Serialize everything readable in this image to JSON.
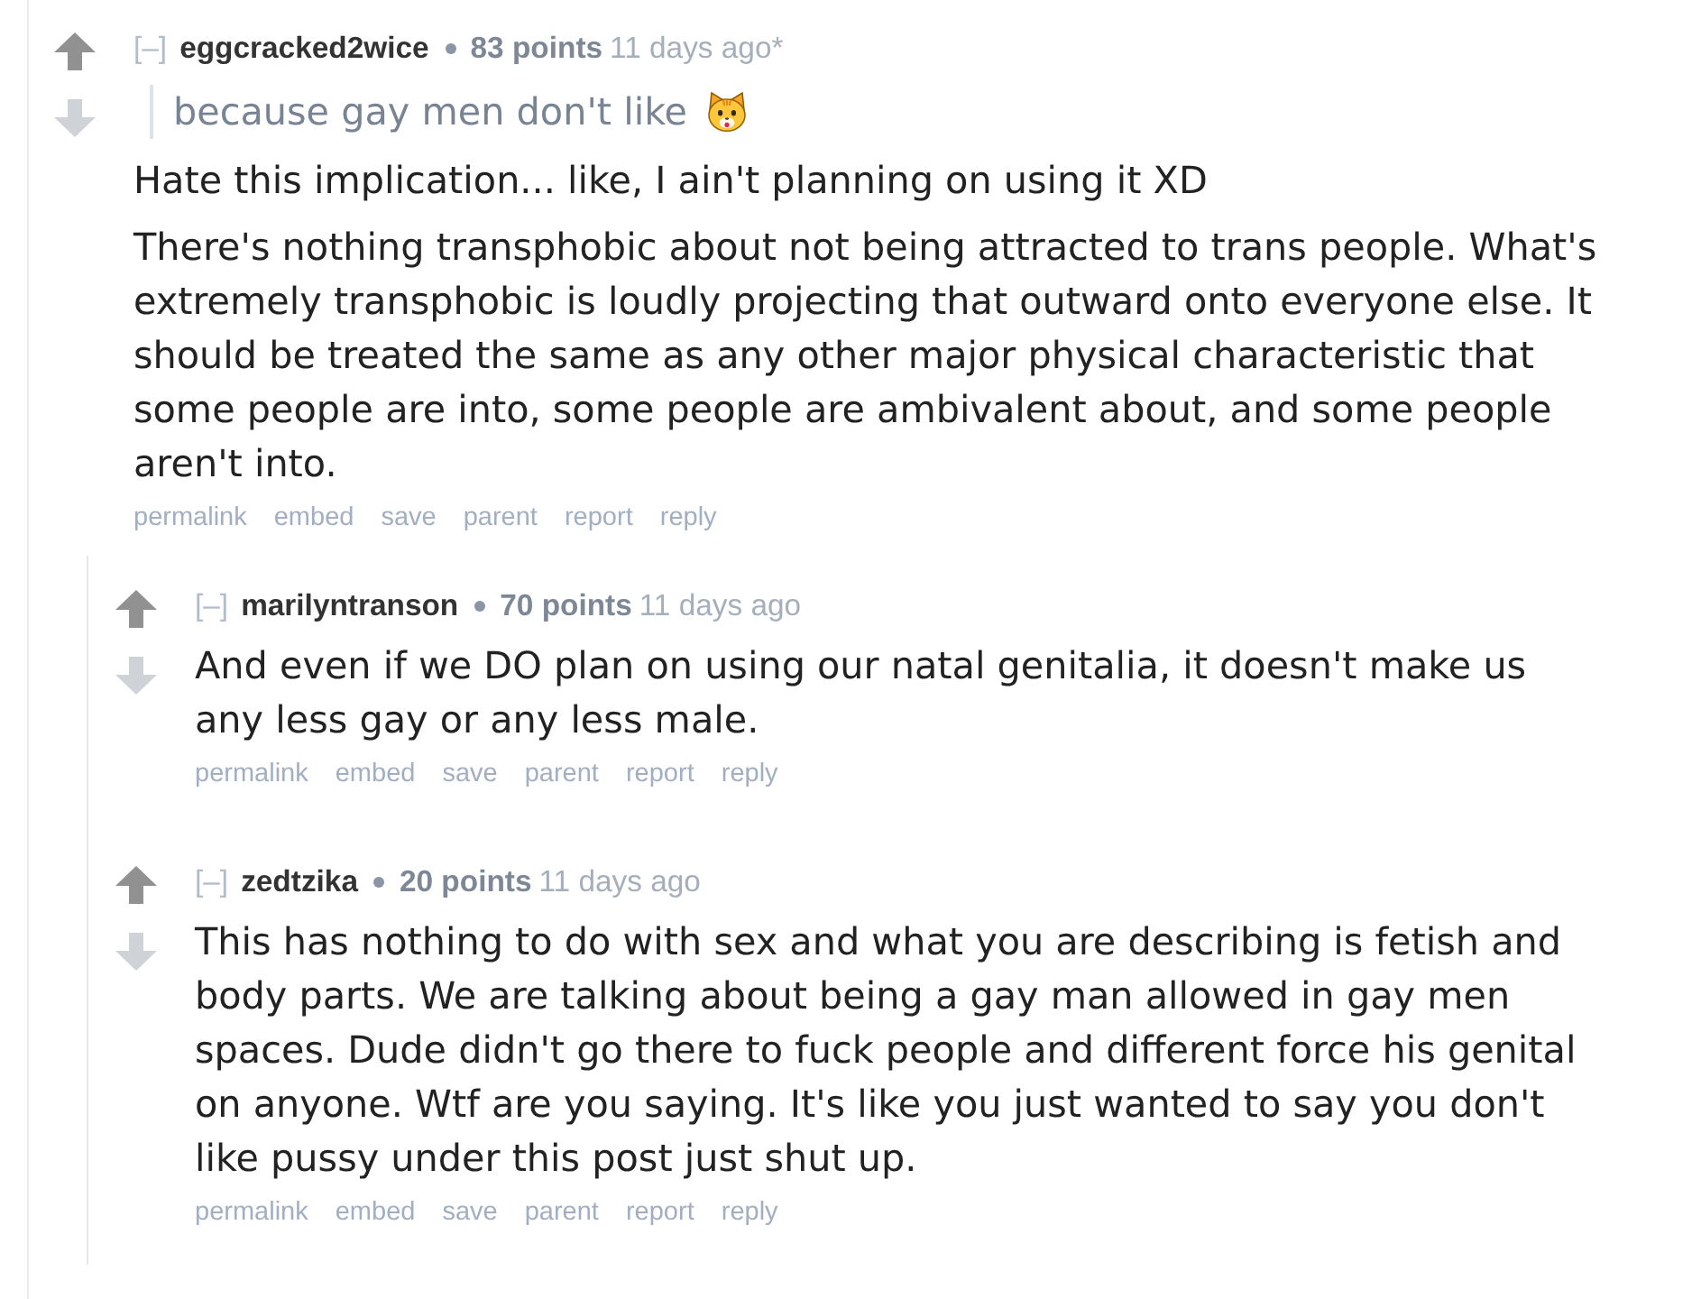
{
  "comments": [
    {
      "collapse": "[–]",
      "author": "eggcracked2wice",
      "score": "83 points",
      "time": "11 days ago*",
      "quote": "because gay men don't like",
      "paragraphs": [
        "Hate this implication... like, I ain't planning on using it XD",
        "There's nothing transphobic about not being attracted to trans people. What's extremely transphobic is loudly projecting that outward onto everyone else. It should be treated the same as any other major physical characteristic that some people are into, some people are ambivalent about, and some people aren't into."
      ],
      "actions": [
        "permalink",
        "embed",
        "save",
        "parent",
        "report",
        "reply"
      ],
      "children": [
        {
          "collapse": "[–]",
          "author": "marilyntranson",
          "score": "70 points",
          "time": "11 days ago",
          "paragraphs": [
            "And even if we DO plan on using our natal genitalia, it doesn't make us any less gay or any less male."
          ],
          "actions": [
            "permalink",
            "embed",
            "save",
            "parent",
            "report",
            "reply"
          ]
        },
        {
          "collapse": "[–]",
          "author": "zedtzika",
          "score": "20 points",
          "time": "11 days ago",
          "paragraphs": [
            "This has nothing to do with sex and what you are describing is fetish and body parts. We are talking about being a gay man allowed in gay men spaces. Dude didn't go there to fuck people and different force his genital on anyone. Wtf are you saying. It's like you just wanted to say you don't like pussy under this post just shut up."
          ],
          "actions": [
            "permalink",
            "embed",
            "save",
            "parent",
            "report",
            "reply"
          ]
        }
      ]
    }
  ]
}
